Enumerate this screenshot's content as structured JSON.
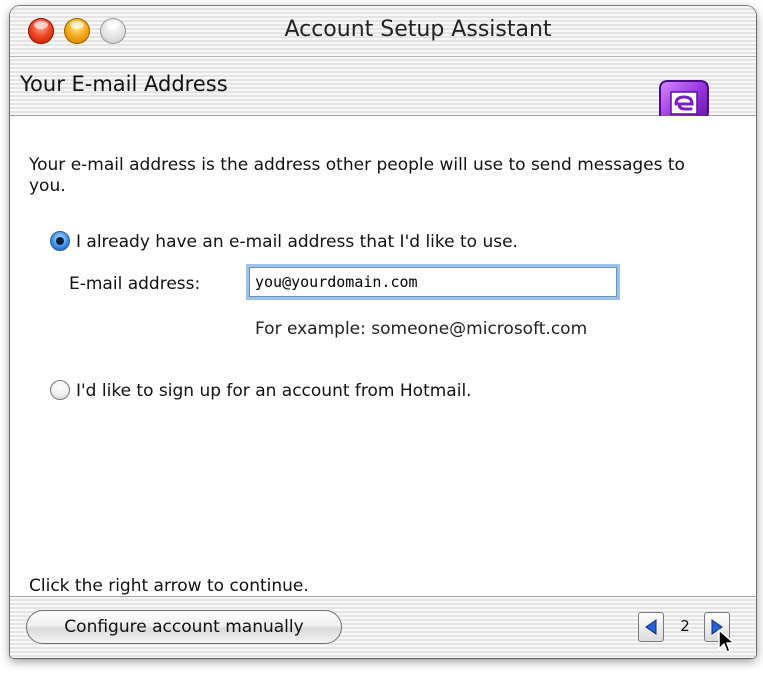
{
  "window": {
    "title": "Account Setup Assistant"
  },
  "header": {
    "title": "Your E-mail Address",
    "logo_icon": "entourage-logo-icon"
  },
  "content": {
    "intro": "Your e-mail address is the address other people will use to send messages to you.",
    "option_existing": {
      "label": "I already have an e-mail address that I'd like to use.",
      "selected": true
    },
    "email_field": {
      "label": "E-mail address:",
      "value": "you@yourdomain.com"
    },
    "example_hint": "For example: someone@microsoft.com",
    "option_hotmail": {
      "label": "I'd like to sign up for an account from Hotmail.",
      "selected": false
    },
    "continue_hint": "Click the right arrow to continue."
  },
  "footer": {
    "configure_button": "Configure account manually",
    "page_number": "2",
    "prev_icon": "left-arrow-icon",
    "next_icon": "right-arrow-icon"
  },
  "colors": {
    "accent": "#3b8ee6",
    "focus_ring": "#9cc1ea",
    "logo_purple": "#8a2bd6"
  }
}
